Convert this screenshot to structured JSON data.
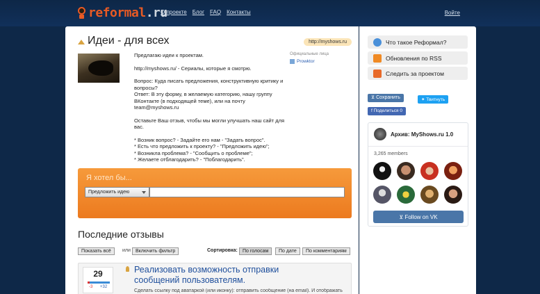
{
  "header": {
    "logo_part1": "reformal",
    "logo_part2": ".ru",
    "nav": [
      "О проекте",
      "Блог",
      "FAQ",
      "Контакты"
    ],
    "login": "Войте"
  },
  "project": {
    "title": "Идеи - для всех",
    "url_badge": "http://myshows.ru",
    "official_label": "Официальные лица",
    "official_user": "Prowktor",
    "description": [
      "Предлагаю идеи к проектам.",
      "http://myshows.ru/ - Сериалы, которые я смотрю.",
      "Вопрос: Куда писать предложения, конструктивную критику и вопросы?\nОтвет: В эту форму, в желаемую категорию, нашу группу ВКонтакте (в подходящей теме), или на почту team@myshows.ru",
      "Оставьте Ваш отзыв, чтобы мы могли улучшать наш сайт для вас.",
      "* Возник вопрос? - Задайте его нам - \"Задать вопрос\".\n* Есть что предложить к проекту? - \"Предложить идею\";\n* Возникла проблема? - \"Сообщить о проблеме\";\n* Желаете отблагодарить? - \"Поблагодарить\"."
    ]
  },
  "idea_form": {
    "label": "Я хотел бы...",
    "select_value": "Предложить идею",
    "input_value": ""
  },
  "reviews": {
    "title": "Последние отзывы",
    "show_all": "Показать всё",
    "or": "или",
    "enable_filter": "Включить фильтр",
    "sort_label": "Сортировка:",
    "sort_options": [
      "По голосам",
      "По дате",
      "По комментариям"
    ],
    "sort_selected": "По голосам",
    "items": [
      {
        "votes": "29",
        "neg": "-3",
        "pos": "+32",
        "pos_fraction": 0.91,
        "title": "Реализовать возможность отправки сообщений пользователям.",
        "text": "Сделать ссылку под аватаркой (или иконку): отправить сообщение (на email). И отображать"
      }
    ]
  },
  "sidebar": {
    "buttons": [
      {
        "label": "Что такое Реформал?",
        "icon": "chat-icon"
      },
      {
        "label": "Обновления по RSS",
        "icon": "rss-icon"
      },
      {
        "label": "Следить за проектом",
        "icon": "follow-icon"
      }
    ],
    "vk_save": "Сохранить",
    "tweet": "Твитнуть",
    "fb_share": "Поделиться 0",
    "vk_widget": {
      "name": "Архив: MyShows.ru 1.0",
      "members": "3,265 members",
      "follow": "Follow on VK"
    }
  },
  "colors": {
    "background": "#0e2848",
    "accent_orange": "#ec7a1f",
    "link_blue": "#1f4f9c",
    "vk_blue": "#4a76a8"
  }
}
